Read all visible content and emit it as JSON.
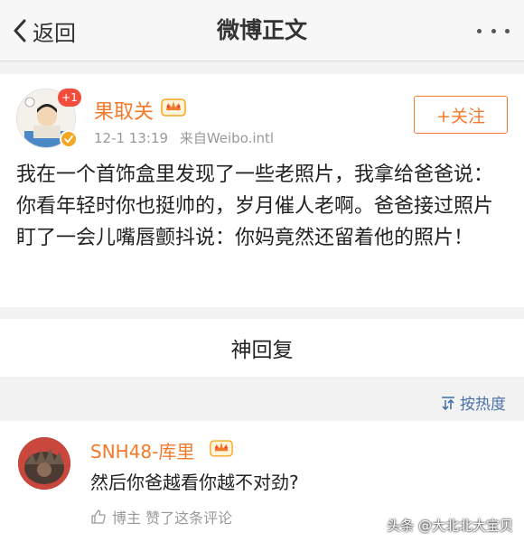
{
  "nav": {
    "back_label": "返回",
    "title": "微博正文",
    "more_icon": "more-horizontal-icon"
  },
  "post": {
    "author": "果取关",
    "notification_badge": "+1",
    "timestamp": "12-1 13:19",
    "source": "来自Weibo.intl",
    "follow_label": "+关注",
    "text": "我在一个首饰盒里发现了一些老照片，我拿给爸爸说：你看年轻时你也挺帅的，岁月催人老啊。爸爸接过照片盯了一会儿嘴唇颤抖说：你妈竟然还留着他的照片！"
  },
  "section": {
    "title": "神回复",
    "sort_label": "按热度"
  },
  "comment": {
    "author": "SNH48-库里",
    "text": "然后你爸越看你越不对劲?",
    "liked_by_label": "博主 赞了这条评论"
  },
  "watermark": "头条 @大北北大宝贝",
  "colors": {
    "name_orange": "#f5792a",
    "link_blue": "#4a72a8",
    "meta_gray": "#999999",
    "badge_red": "#f14c3c"
  }
}
